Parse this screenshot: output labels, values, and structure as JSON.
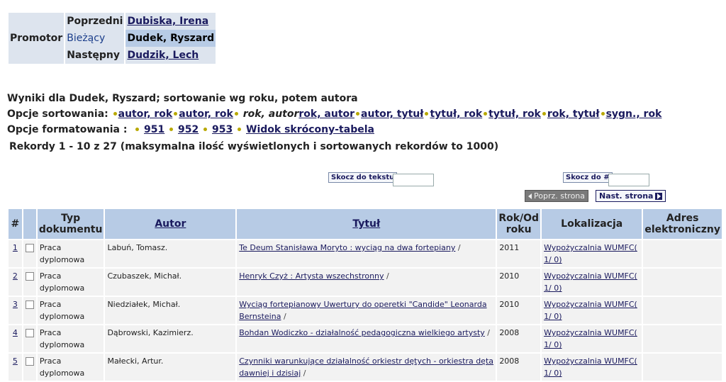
{
  "promotor": {
    "label": "Promotor",
    "prev_label": "Poprzedni",
    "prev_name": "Dubiska, Irena",
    "curr_label": "Bieżący",
    "curr_name": "Dudek, Ryszard",
    "next_label": "Następny",
    "next_name": "Dudzik, Lech"
  },
  "results_title": "Wyniki dla Dudek, Ryszard; sortowanie wg roku, potem autora",
  "sort": {
    "label": "Opcje sortowania:",
    "options": [
      "autor, rok",
      "autor, rok",
      "rok, autor",
      "rok, autor",
      "autor, tytuł",
      "tytuł, rok",
      "tytuł, rok",
      "rok, tytuł",
      "sygn., rok"
    ]
  },
  "format": {
    "label": "Opcje formatowania :",
    "options": [
      "951",
      "952",
      "953",
      "Widok skrócony-tabela"
    ]
  },
  "records_summary": "Rekordy 1 - 10 z 27 (maksymalna ilość wyświetlonych i sortowanych rekordów to 1000)",
  "jump": {
    "text_label": "Skocz do tekstu",
    "num_label": "Skocz do #",
    "prev_page": "Poprz. strona",
    "next_page": "Nast. strona"
  },
  "table": {
    "headers": {
      "num": "#",
      "type": "Typ dokumentu",
      "author": "Autor",
      "title": "Tytuł",
      "year": "Rok/Od roku",
      "location": "Lokalizacja",
      "address": "Adres elektroniczny"
    },
    "rows": [
      {
        "num": "1",
        "type": "Praca dyplomowa",
        "author": "Labuń, Tomasz.",
        "title": "Te Deum Stanisława Moryto : wyciąg na dwa fortepiany",
        "year": "2011",
        "location": "Wypożyczalnia WUMFC( 1/ 0)"
      },
      {
        "num": "2",
        "type": "Praca dyplomowa",
        "author": "Czubaszek, Michał.",
        "title": "Henryk Czyż : Artysta wszechstronny",
        "year": "2010",
        "location": "Wypożyczalnia WUMFC( 1/ 0)"
      },
      {
        "num": "3",
        "type": "Praca dyplomowa",
        "author": "Niedziałek, Michał.",
        "title": "Wyciąg fortepianowy Uwertury do operetki \"Candide\" Leonarda Bernsteina",
        "year": "2010",
        "location": "Wypożyczalnia WUMFC( 1/ 0)"
      },
      {
        "num": "4",
        "type": "Praca dyplomowa",
        "author": "Dąbrowski, Kazimierz.",
        "title": "Bohdan Wodiczko - działalność pedagogiczna wielkiego artysty",
        "year": "2008",
        "location": "Wypożyczalnia WUMFC( 1/ 0)"
      },
      {
        "num": "5",
        "type": "Praca dyplomowa",
        "author": "Małecki, Artur.",
        "title": "Czynniki warunkujące działalność orkiestr dętych - orkiestra dęta dawniej i dzisiaj",
        "year": "2008",
        "location": "Wypożyczalnia WUMFC( 1/ 0)"
      }
    ]
  },
  "colors": {
    "header_bg": "#b7cbe5",
    "nav_bg": "#dde4ee",
    "link": "#1a1a5e",
    "bullet": "#b8a800"
  }
}
